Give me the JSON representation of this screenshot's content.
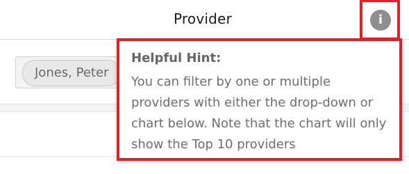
{
  "header": {
    "title": "Provider",
    "info_icon": "info-icon",
    "info_symbol": "i"
  },
  "filter": {
    "selected_provider": "Jones, Peter"
  },
  "tooltip": {
    "title": "Helpful Hint:",
    "text": "You can filter by one or multiple providers with either the drop-down or chart below. Note that the chart will only show the Top 10 providers"
  },
  "colors": {
    "highlight": "#e3202a",
    "icon_bg": "#8e8e8e",
    "text_muted": "#6e6e6e"
  }
}
